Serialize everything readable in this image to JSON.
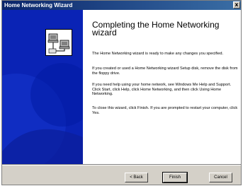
{
  "window": {
    "title": "Home Networking Wizard",
    "close_glyph": "x"
  },
  "content": {
    "heading": "Completing the Home Networking wizard",
    "paragraph1": "The Home Networking wizard is ready to make any changes you specified.",
    "paragraph2": "If you created or used a Home Networking wizard Setup disk, remove the disk from the floppy drive.",
    "paragraph3": "If you need help using your home network, see Windows Me Help and Support. Click Start, click Help, click Home Networking, and then click Using Home Networking.",
    "paragraph4": "To close this wizard, click Finish. If you are prompted to restart your computer, click Yes."
  },
  "buttons": {
    "back": "< Back",
    "finish": "Finish",
    "cancel": "Cancel"
  },
  "colors": {
    "titlebar": "#0a246a",
    "side_panel": "#0a23b5",
    "dialog_face": "#d4d0c8"
  },
  "icons": {
    "wizard": "computer-network-icon"
  }
}
